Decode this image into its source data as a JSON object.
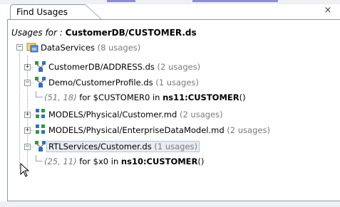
{
  "tab": {
    "title": "Find Usages",
    "close_glyph": "×"
  },
  "header": {
    "label": "Usages for : ",
    "value": "CustomerDB/CUSTOMER.ds"
  },
  "tree": {
    "root": {
      "name": "DataServices",
      "count": "(8 usages)",
      "toggle": "−"
    },
    "items": [
      {
        "name": "CustomerDB/ADDRESS.ds",
        "count": "(2 usages)",
        "toggle": "+"
      },
      {
        "name": "Demo/CustomerProfile.ds",
        "count": "(1 usages)",
        "toggle": "−",
        "usage": {
          "loc": "(51, 18)",
          "pre": " for $CUSTOMER0 in ",
          "bold": "ns11:CUSTOMER",
          "post": "()"
        }
      },
      {
        "name": "MODELS/Physical/Customer.md",
        "count": "(2 usages)",
        "toggle": "+"
      },
      {
        "name": "MODELS/Physical/EnterpriseDataModel.md",
        "count": "(2 usages)",
        "toggle": "+"
      },
      {
        "name": "RTLServices/Customer.ds",
        "count": "(1 usages)",
        "toggle": "−",
        "usage": {
          "loc": "(25, 11)",
          "pre": " for $x0 in ",
          "bold": "ns10:CUSTOMER",
          "post": "()"
        }
      }
    ]
  },
  "icons": {
    "dataservice": "dataservice-icon",
    "model": "model-grid-icon",
    "folder": "dataservices-folder-icon"
  },
  "colors": {
    "count_gray": "#7a7a7a",
    "selection_bg": "#e8ecf2",
    "icon_blue": "#2f6fc4",
    "icon_green": "#2f9a3a"
  }
}
